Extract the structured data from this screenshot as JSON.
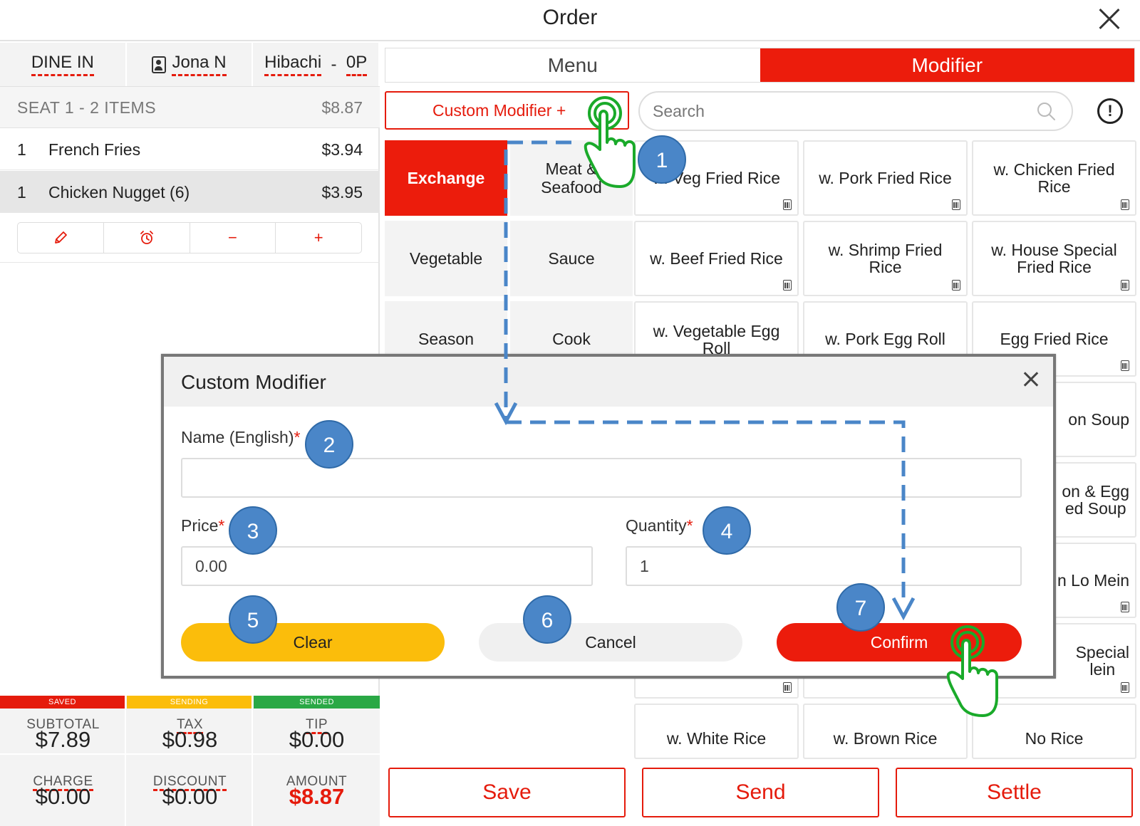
{
  "header": {
    "title": "Order"
  },
  "order_bar": {
    "type": "DINE IN",
    "server": "Jona N",
    "table": "Hibachi",
    "table_sep": "-",
    "guests": "0P"
  },
  "seat": {
    "label": "SEAT 1 - 2 ITEMS",
    "total": "$8.87"
  },
  "items": [
    {
      "qty": "1",
      "name": "French Fries",
      "price": "$3.94"
    },
    {
      "qty": "1",
      "name": "Chicken Nugget (6)",
      "price": "$3.95"
    }
  ],
  "item_actions": {
    "minus": "−",
    "plus": "+"
  },
  "totals": {
    "saved": "SAVED",
    "sending": "SENDING",
    "sended": "SENDED",
    "subtotal_label": "SUBTOTAL",
    "subtotal": "$7.89",
    "tax_label": "TAX",
    "tax": "$0.98",
    "tip_label": "TIP",
    "tip": "$0.00",
    "charge_label": "CHARGE",
    "charge": "$0.00",
    "discount_label": "DISCOUNT",
    "discount": "$0.00",
    "amount_label": "AMOUNT",
    "amount": "$8.87"
  },
  "colors": {
    "accent_red": "#ec1c0c",
    "saved": "#e51b0c",
    "sending": "#fbbd0b",
    "sended": "#2aa845",
    "annotation_blue": "#4a86c8",
    "annotation_green": "#1aaa2a"
  },
  "tabs": {
    "menu": "Menu",
    "modifier": "Modifier"
  },
  "toolbar": {
    "custom_modifier": "Custom Modifier  +",
    "search_placeholder": "Search",
    "alert": "!"
  },
  "categories": [
    "Exchange",
    "Meat &\nSeafood",
    "Vegetable",
    "Sauce",
    "Season",
    "Cook"
  ],
  "modifiers": [
    "w. Veg Fried Rice",
    "w. Pork Fried Rice",
    "w. Chicken Fried Rice",
    "w. Beef Fried Rice",
    "w. Shrimp Fried Rice",
    "w. House Special Fried Rice",
    "w. Vegetable Egg Roll",
    "w. Pork Egg Roll",
    "Egg Fried Rice",
    "on Soup",
    "on & Egg\ned Soup",
    "n Lo Mein",
    "Special\nlein",
    "w. White Rice",
    "w. Brown Rice",
    "No Rice"
  ],
  "bottom_buttons": {
    "save": "Save",
    "send": "Send",
    "settle": "Settle"
  },
  "modal": {
    "title": "Custom Modifier",
    "name_label": "Name (English)",
    "name_value": "",
    "price_label": "Price",
    "price_value": "0.00",
    "quantity_label": "Quantity",
    "quantity_value": "1",
    "required_mark": "*",
    "clear": "Clear",
    "cancel": "Cancel",
    "confirm": "Confirm"
  },
  "annotations": [
    "1",
    "2",
    "3",
    "4",
    "5",
    "6",
    "7"
  ]
}
